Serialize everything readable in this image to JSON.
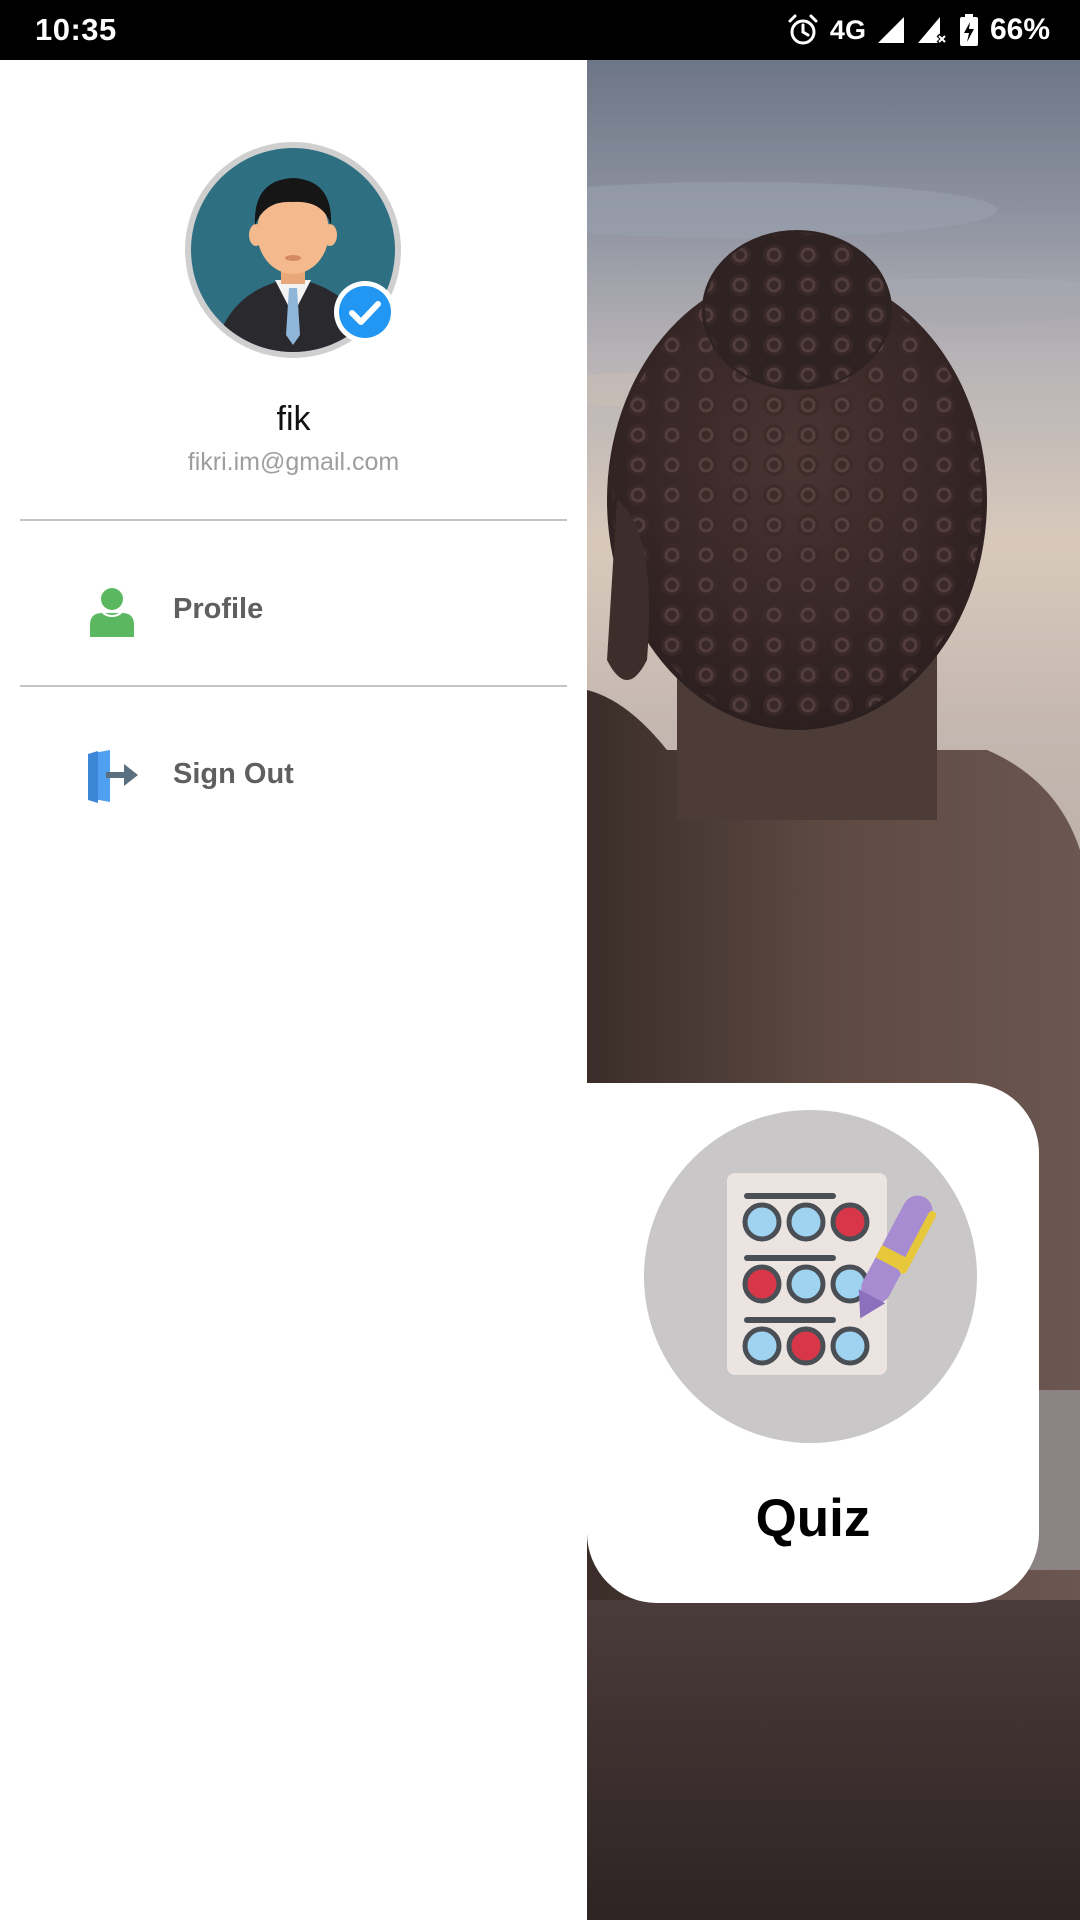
{
  "status_bar": {
    "time": "10:35",
    "network": "4G",
    "battery": "66%"
  },
  "drawer": {
    "user": {
      "name": "fik",
      "email": "fikri.im@gmail.com"
    },
    "menu": [
      {
        "label": "Profile",
        "icon": "person-icon"
      },
      {
        "label": "Sign Out",
        "icon": "sign-out-icon"
      }
    ]
  },
  "main": {
    "card": {
      "title": "Quiz",
      "icon": "quiz-sheet-icon"
    }
  },
  "colors": {
    "status_bar_bg": "#000000",
    "drawer_bg": "#ffffff",
    "avatar_bg": "#2e6f82",
    "verified_badge": "#2196f3",
    "profile_icon": "#5cb860",
    "signout_icon": "#4fa0f0",
    "menu_text": "#5f5f5f",
    "quiz_circle": "#c9c7c8"
  }
}
